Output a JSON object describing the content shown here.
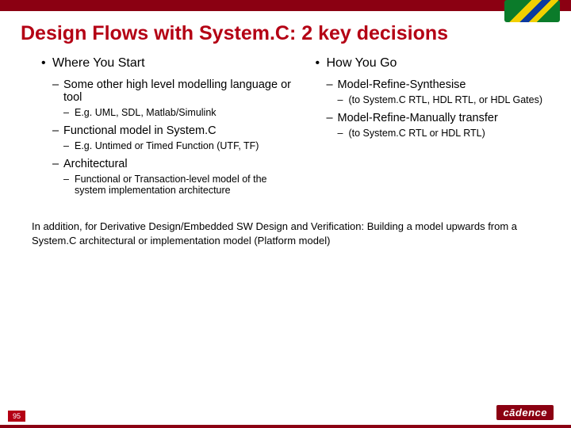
{
  "title": "Design Flows with System.C:  2 key decisions",
  "left": {
    "h": "Where You Start",
    "items": [
      {
        "t": "Some other high level modelling language or tool",
        "sub": [
          "E.g. UML, SDL, Matlab/Simulink"
        ]
      },
      {
        "t": "Functional model in System.C",
        "sub": [
          "E.g. Untimed or Timed Function (UTF, TF)"
        ]
      },
      {
        "t": "Architectural",
        "sub": [
          "Functional or Transaction-level model of the system implementation architecture"
        ]
      }
    ]
  },
  "right": {
    "h": "How You Go",
    "items": [
      {
        "t": "Model-Refine-Synthesise",
        "sub": [
          "(to System.C RTL, HDL RTL, or HDL Gates)"
        ]
      },
      {
        "t": "Model-Refine-Manually transfer",
        "sub": [
          "(to System.C RTL or HDL RTL)"
        ]
      }
    ]
  },
  "addendum": "In addition, for Derivative Design/Embedded SW Design and Verification:   Building a model upwards from a System.C architectural or implementation model (Platform model)",
  "page": "95",
  "logo": "cādence"
}
